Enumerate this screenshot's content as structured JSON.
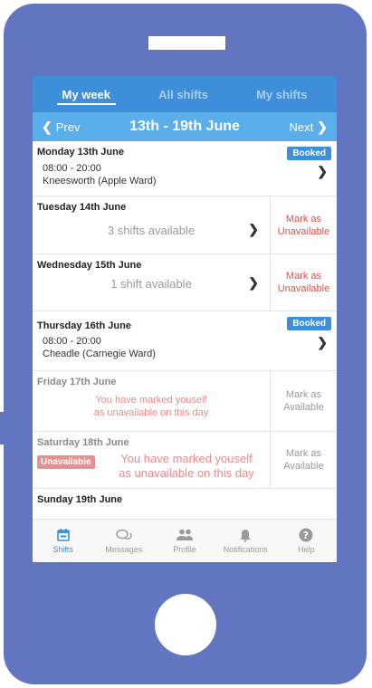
{
  "tabs": [
    {
      "label": "My week",
      "active": true
    },
    {
      "label": "All shifts",
      "active": false
    },
    {
      "label": "My shifts",
      "active": false
    }
  ],
  "week_nav": {
    "prev_label": "Prev",
    "next_label": "Next",
    "title": "13th - 19th June"
  },
  "days": {
    "mon": {
      "name": "Monday 13th June",
      "badge": "Booked",
      "time": "08:00 - 20:00",
      "location": "Kneesworth (Apple Ward)"
    },
    "tue": {
      "name": "Tuesday 14th June",
      "availability": "3 shifts available",
      "mark_line1": "Mark as",
      "mark_line2": "Unavailable"
    },
    "wed": {
      "name": "Wednesday 15th June",
      "availability": "1 shift available",
      "mark_line1": "Mark as",
      "mark_line2": "Unavailable"
    },
    "thu": {
      "name": "Thursday 16th June",
      "badge": "Booked",
      "time": "08:00 - 20:00",
      "location": "Cheadle (Carnegie Ward)"
    },
    "fri": {
      "name": "Friday 17th June",
      "message_line1": "You have marked youself",
      "message_line2": "as unavailable on this day",
      "mark_line1": "Mark as",
      "mark_line2": "Available"
    },
    "sat": {
      "name": "Saturday 18th June",
      "badge": "Unavailable",
      "message_line1": "You have marked youself",
      "message_line2": "as unavailable on this day",
      "mark_line1": "Mark as",
      "mark_line2": "Available"
    },
    "sun": {
      "name": "Sunday 19th June"
    }
  },
  "bottom_nav": [
    {
      "label": "Shifts",
      "icon": "calendar-icon",
      "active": true
    },
    {
      "label": "Messages",
      "icon": "chat-icon",
      "active": false
    },
    {
      "label": "Profile",
      "icon": "people-icon",
      "active": false
    },
    {
      "label": "Notifications",
      "icon": "bell-icon",
      "active": false
    },
    {
      "label": "Help",
      "icon": "help-icon",
      "active": false
    }
  ],
  "colors": {
    "phone": "#6175c0",
    "tab_bar": "#3d8fd9",
    "week_bar": "#5aaee9",
    "unavailable_red": "#d9534f"
  }
}
